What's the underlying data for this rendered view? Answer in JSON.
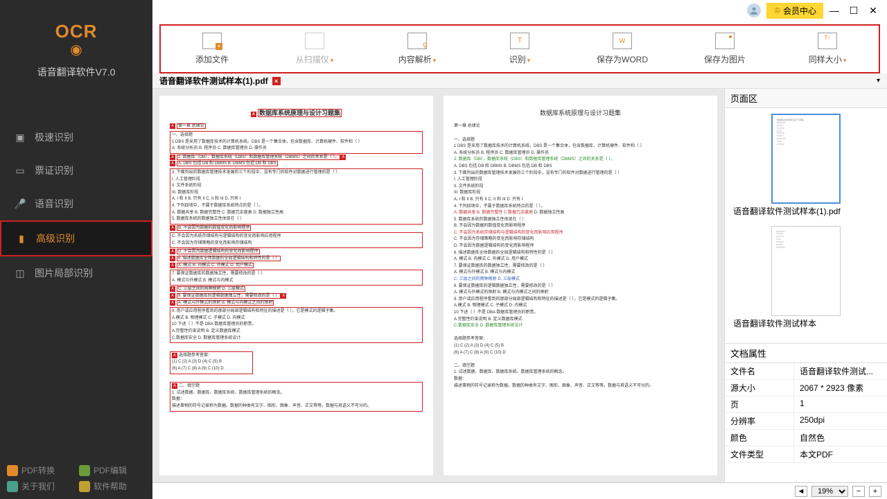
{
  "app": {
    "logo_text": "OCR",
    "title": "语音翻译软件V7.0"
  },
  "nav": {
    "items": [
      {
        "icon": "speed",
        "label": "极速识别"
      },
      {
        "icon": "ticket",
        "label": "票证识别"
      },
      {
        "icon": "voice",
        "label": "语音识别"
      },
      {
        "icon": "advanced",
        "label": "高级识别",
        "active": true
      },
      {
        "icon": "partial",
        "label": "图片局部识别"
      }
    ]
  },
  "bottom_links": [
    {
      "label": "PDF转换",
      "color": "#e08a2c"
    },
    {
      "label": "PDF编辑",
      "color": "#6a9a3a"
    },
    {
      "label": "关于我们",
      "color": "#4aa08a"
    },
    {
      "label": "软件帮助",
      "color": "#c0a030"
    }
  ],
  "titlebar": {
    "member": "会员中心"
  },
  "toolbar": [
    {
      "label": "添加文件",
      "dropdown": false
    },
    {
      "label": "从扫描仪",
      "dropdown": true,
      "disabled": true
    },
    {
      "label": "内容解析",
      "dropdown": true
    },
    {
      "label": "识别",
      "dropdown": true
    },
    {
      "label": "保存为WORD",
      "dropdown": false
    },
    {
      "label": "保存为图片",
      "dropdown": false
    },
    {
      "label": "同样大小",
      "dropdown": true
    }
  ],
  "tab": {
    "name": "语音翻译软件测试样本(1).pdf"
  },
  "doc": {
    "title": "数据库系统原理与设计习题集",
    "section": "第一章 总绪论",
    "q_header": "一、选择题",
    "q1": "1 DBS 是采用了数据库技术的计算机系统。DBS 是一个集合体，包含数据库、计算机硬件、软件和（ ）",
    "q1_opts": "A. 系统分析员 B. 程序员 C. 数据库管理员 D. 操作员",
    "q2": "2. 数据库（DB）、数据库系统（DBS）和数据库管理系统（DBMS）之间的关系是（ ）。",
    "q2_opts": "A. DBS 包括 DB 和 DBMS B. DBMS 包括 DB 和 DBS",
    "q3": "3. 下面列出的数据库管理技术发展的三个阶段中，没有专门的软件对数据进行管理的是（ ）",
    "q3_a": "I. 人工管理阶段",
    "q3_b": "II. 文件系统阶段",
    "q3_c": "III. 数据库阶段",
    "q3_opts": "A. I 和 II   B. 只有 II   C. II 和 III   D. 只有 I",
    "q4": "4. 下列四项中，不属于数据库系统特点的是（ ）。",
    "q4_opts": "A. 数据共享 B. 数据完整性 C. 数据冗余度高 D. 数据独立性高",
    "q5": "5. 数据库系统的数据独立性体现在（ ）",
    "q5_a": "B. 不会因为数据的数值变化而影响程序",
    "q5_b": "C. 不会因为系统存储结构与逻辑结构的变化而影响应用程序",
    "q5_c": "C. 不会因为存储策略的变化而影响存储结构",
    "q5_d": "D. 不会因为数据逻辑结构的变化而影响程序",
    "q6": "6. 描述数据库全体数据的全局逻辑结构和特性的是（ ）",
    "q6_opts": "A. 模式 B. 内模式 C. 外模式 D. 用户模式",
    "q7": "7. 要保证数据库的数据独立性，需要修改的是（ ）",
    "q7_opts": "A. 模式与外模式 B. 模式与内模式",
    "q7_opts2": "C. 三层之间的两种映射 D. 三层模式",
    "q8": "8. 要保证数据库的逻辑数据独立性，需要修改的是（ ）",
    "q8_opts": "A. 模式与外模式的映射 B. 模式与内模式之间的映射",
    "q9": "9. 用户或应用程序看到的那部分局部逻辑结构和特征的描述是（ ），它是模式的逻辑子集。",
    "q9_opts": "A.模式 B. 物理模式 C. 子模式 D. 内模式",
    "q10": "10 下述（ ）不是 DBA 数据库管理员的职责。",
    "q10_opts": "A.完整性约束说明 B. 定义数据库模式",
    "q10_opts2": "C.数据库安全 D. 数据库管理系统设计",
    "ans_header": "选择题参考答案：",
    "ans1": "(1) C (2) A (3) D (4) C (5) B",
    "ans2": "(6) A (7) C (8) A (9) C (10) D",
    "fill_header": "二、填空题",
    "fill1": "1. 试述数据、数据库、数据库系统、数据库管理系统的概念。",
    "fill_sub": "数据：",
    "fill2": "描述事物的符号记录称为数据。数据的种类有文字、图形、图象、声音、正文等等。数据与其语义不可分的。"
  },
  "right": {
    "panel_title": "页面区",
    "thumb1_label": "语音翻译软件测试样本(1).pdf",
    "thumb2_label": "语音翻译软件测试样本",
    "props_title": "文档属性",
    "props": [
      {
        "k": "文件名",
        "v": "语音翻译软件测试..."
      },
      {
        "k": "源大小",
        "v": "2067 * 2923 像素"
      },
      {
        "k": "页",
        "v": "1"
      },
      {
        "k": "分辨率",
        "v": "250dpi"
      },
      {
        "k": "颜色",
        "v": "自然色"
      },
      {
        "k": "文件类型",
        "v": "本文PDF"
      }
    ]
  },
  "status": {
    "zoom": "19%"
  }
}
